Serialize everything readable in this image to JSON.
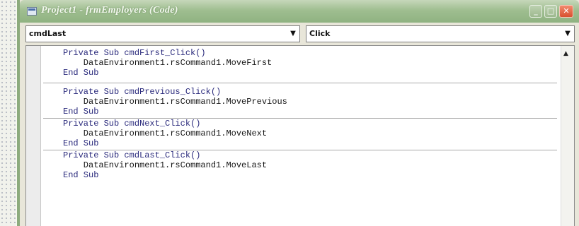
{
  "window": {
    "title": "Project1 - frmEmployers (Code)",
    "controls": {
      "minimize": "_",
      "maximize": "□",
      "close": "✕"
    }
  },
  "object_combo": {
    "value": "cmdLast",
    "icon": "chevron-down-icon"
  },
  "procedure_combo": {
    "value": "Click",
    "icon": "chevron-down-icon"
  },
  "code": {
    "procedures": [
      {
        "signature": "Private Sub cmdFirst_Click()",
        "body": "    DataEnvironment1.rsCommand1.MoveFirst",
        "end": "End Sub"
      },
      {
        "signature": "Private Sub cmdPrevious_Click()",
        "body": "    DataEnvironment1.rsCommand1.MovePrevious",
        "end": "End Sub"
      },
      {
        "signature": "Private Sub cmdNext_Click()",
        "body": "    DataEnvironment1.rsCommand1.MoveNext",
        "end": "End Sub"
      },
      {
        "signature": "Private Sub cmdLast_Click()",
        "body": "    DataEnvironment1.rsCommand1.MoveLast",
        "end": "End Sub"
      }
    ]
  },
  "colors": {
    "titlebar": "#9fbe90",
    "close_button": "#d8502f",
    "keyword": "#2a2a7c"
  }
}
